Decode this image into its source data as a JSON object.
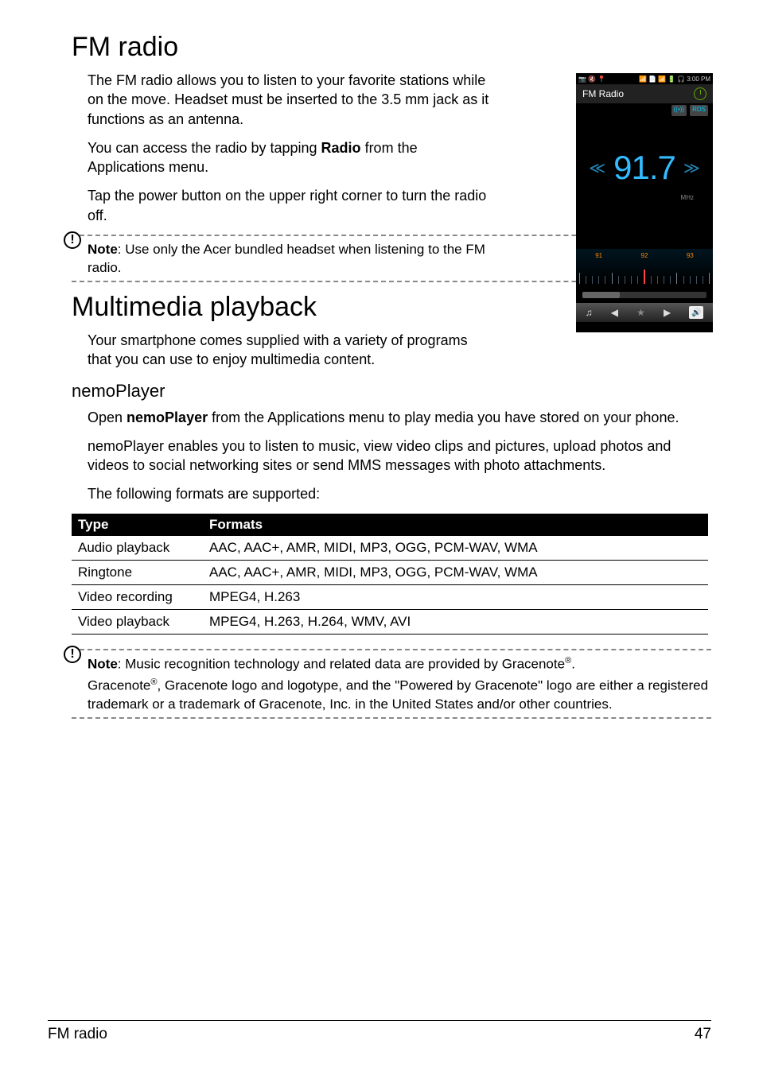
{
  "h1_fm": "FM radio",
  "p_fm1": "The FM radio allows you to listen to your favorite stations while on the move. Headset must be inserted to the 3.5 mm jack as it functions as an antenna.",
  "p_fm2_a": "You can access the radio by tapping ",
  "p_fm2_b": "Radio",
  "p_fm2_c": " from the Applications menu.",
  "p_fm3": "Tap the power button on the upper right corner to turn the radio off.",
  "note_label": "Note",
  "note_fm": ": Use only the Acer bundled headset when listening to the FM radio.",
  "h1_mm": "Multimedia playback",
  "p_mm1": "Your smartphone comes supplied with a variety of programs that you can use to enjoy multimedia content.",
  "h2_nemo": "nemoPlayer",
  "p_nemo1_a": "Open ",
  "p_nemo1_b": "nemoPlayer",
  "p_nemo1_c": " from the Applications menu to play media you have stored on your phone.",
  "p_nemo2": "nemoPlayer enables you to listen to music, view video clips and pictures, upload photos and videos to social networking sites or send MMS messages with photo attachments.",
  "p_nemo3": "The following formats are supported:",
  "tbl": {
    "head": [
      "Type",
      "Formats"
    ],
    "rows": [
      [
        "Audio playback",
        "AAC, AAC+, AMR, MIDI, MP3, OGG, PCM-WAV, WMA"
      ],
      [
        "Ringtone",
        "AAC, AAC+, AMR, MIDI, MP3, OGG, PCM-WAV, WMA"
      ],
      [
        "Video recording",
        "MPEG4, H.263"
      ],
      [
        "Video playback",
        "MPEG4, H.263, H.264, WMV, AVI"
      ]
    ]
  },
  "note_grace1": ": Music recognition technology and related data are provided by Gracenote",
  "note_grace1_end": ".",
  "note_grace2_a": "Gracenote",
  "note_grace2_b": ", Gracenote logo and logotype, and the \"Powered by Gracenote\" logo are either a registered trademark or a trademark of Gracenote, Inc. in the United States and/or other countries.",
  "footer_left": "FM radio",
  "footer_right": "47",
  "phone": {
    "time": "3:00 PM",
    "title": "FM Radio",
    "rds": "RDS",
    "signal_icon": "((•))",
    "freq": "91.7",
    "mhz": "MHz",
    "dial_labels": [
      "91",
      "92",
      "93"
    ],
    "status_left": [
      "📷",
      "🔇",
      "📍"
    ],
    "status_right": [
      "📶",
      "📄",
      "📶",
      "🔋",
      "🎧"
    ]
  }
}
